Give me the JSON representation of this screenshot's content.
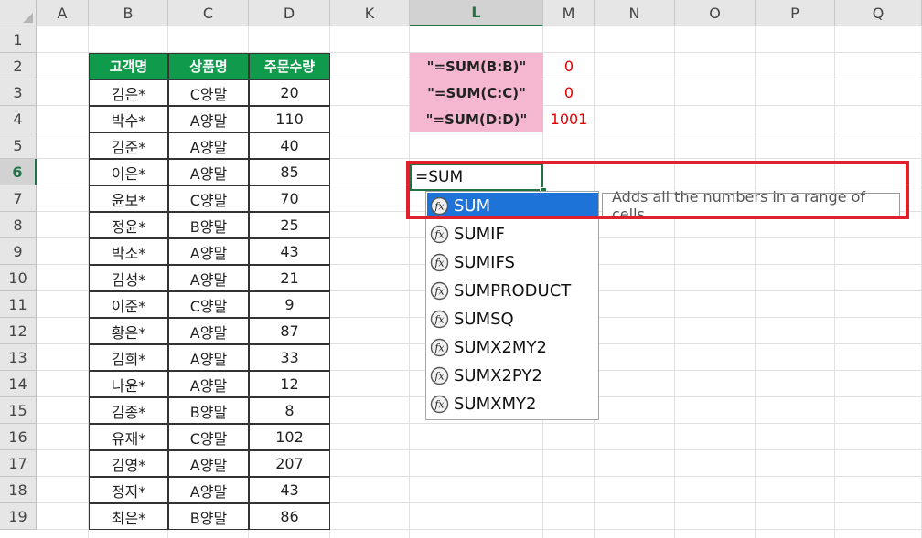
{
  "columns": [
    "A",
    "B",
    "C",
    "D",
    "K",
    "L",
    "M",
    "N",
    "O",
    "P",
    "Q"
  ],
  "rows": [
    "1",
    "2",
    "3",
    "4",
    "5",
    "6",
    "7",
    "8",
    "9",
    "10",
    "11",
    "12",
    "13",
    "14",
    "15",
    "16",
    "17",
    "18",
    "19"
  ],
  "table": {
    "headers": [
      "고객명",
      "상품명",
      "주문수량"
    ],
    "data": [
      [
        "김은*",
        "C양말",
        "20"
      ],
      [
        "박수*",
        "A양말",
        "110"
      ],
      [
        "김준*",
        "A양말",
        "40"
      ],
      [
        "이은*",
        "A양말",
        "85"
      ],
      [
        "윤보*",
        "C양말",
        "70"
      ],
      [
        "정윤*",
        "B양말",
        "25"
      ],
      [
        "박소*",
        "A양말",
        "43"
      ],
      [
        "김성*",
        "A양말",
        "21"
      ],
      [
        "이준*",
        "C양말",
        "9"
      ],
      [
        "황은*",
        "A양말",
        "87"
      ],
      [
        "김희*",
        "A양말",
        "33"
      ],
      [
        "나윤*",
        "A양말",
        "12"
      ],
      [
        "김종*",
        "B양말",
        "8"
      ],
      [
        "유재*",
        "C양말",
        "102"
      ],
      [
        "김영*",
        "A양말",
        "207"
      ],
      [
        "정지*",
        "A양말",
        "43"
      ],
      [
        "최은*",
        "B양말",
        "86"
      ]
    ]
  },
  "formulas": [
    {
      "label": "\"=SUM(B:B)\"",
      "value": "0"
    },
    {
      "label": "\"=SUM(C:C)\"",
      "value": "0"
    },
    {
      "label": "\"=SUM(D:D)\"",
      "value": "1001"
    }
  ],
  "edit_cell": {
    "text": "=SUM"
  },
  "autocomplete": {
    "items": [
      "SUM",
      "SUMIF",
      "SUMIFS",
      "SUMPRODUCT",
      "SUMSQ",
      "SUMX2MY2",
      "SUMX2PY2",
      "SUMXMY2"
    ],
    "selected": "SUM",
    "icon": "function-fx-icon"
  },
  "tooltip": "Adds all the numbers in a range of cells",
  "colors": {
    "header_green": "#0f9a4c",
    "pink": "#f4b7cf",
    "red_value": "#e00000",
    "highlight_box": "#e0202a",
    "selection_blue": "#1e73d8"
  }
}
